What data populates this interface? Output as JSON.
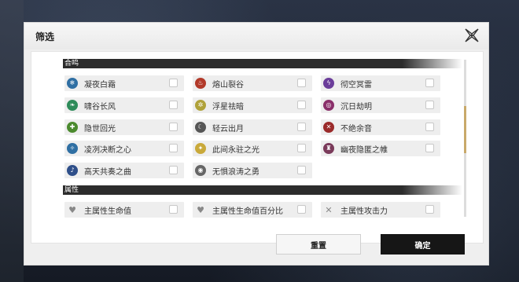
{
  "dialog": {
    "title": "筛选",
    "sections": {
      "resonance": {
        "header": "合鸣",
        "items": [
          {
            "label": "凝夜白霜",
            "icon": "frost-icon",
            "color": "#2f6fa3"
          },
          {
            "label": "熔山裂谷",
            "icon": "fire-icon",
            "color": "#b23a2a"
          },
          {
            "label": "彻空冥雷",
            "icon": "thunder-icon",
            "color": "#6b3d9a"
          },
          {
            "label": "啸谷长风",
            "icon": "wind-icon",
            "color": "#2e8c5a"
          },
          {
            "label": "浮星祛暗",
            "icon": "star-icon",
            "color": "#b0a23a"
          },
          {
            "label": "沉日劫明",
            "icon": "havoc-icon",
            "color": "#8a2f6a"
          },
          {
            "label": "隐世回光",
            "icon": "heal-icon",
            "color": "#4b8a2e"
          },
          {
            "label": "轻云出月",
            "icon": "moon-icon",
            "color": "#555555"
          },
          {
            "label": "不绝余音",
            "icon": "echo-icon",
            "color": "#9a2a2a"
          },
          {
            "label": "凌冽决断之心",
            "icon": "frost-heart-icon",
            "color": "#2f6fa3"
          },
          {
            "label": "此间永驻之光",
            "icon": "light-icon",
            "color": "#c9a93a"
          },
          {
            "label": "幽夜隐匿之帷",
            "icon": "veil-icon",
            "color": "#7a3a5a"
          },
          {
            "label": "高天共奏之曲",
            "icon": "melody-icon",
            "color": "#2f4f8a"
          },
          {
            "label": "无惧浪涛之勇",
            "icon": "wave-icon",
            "color": "#666666"
          }
        ]
      },
      "attribute": {
        "header": "属性",
        "items": [
          {
            "label": "主属性生命值",
            "icon": "hp-icon"
          },
          {
            "label": "主属性生命值百分比",
            "icon": "hp-percent-icon"
          },
          {
            "label": "主属性攻击力",
            "icon": "atk-icon"
          }
        ]
      }
    },
    "buttons": {
      "reset": "重置",
      "confirm": "确定"
    }
  }
}
